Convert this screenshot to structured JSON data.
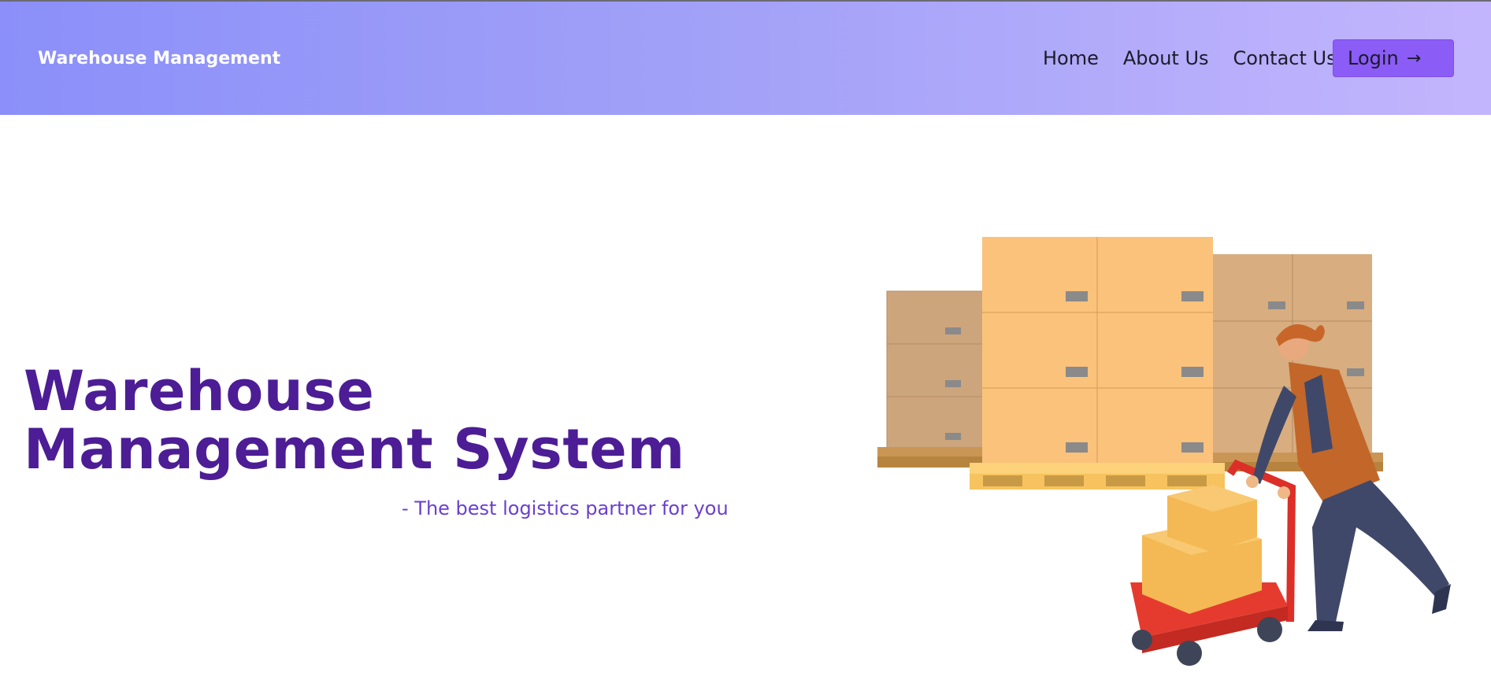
{
  "navbar": {
    "brand": "Warehouse Management",
    "links": [
      "Home",
      "About Us",
      "Contact Us"
    ],
    "login_label": "Login",
    "login_icon": "arrow-right-icon",
    "gradient_start": "#8b8ff9",
    "gradient_end": "#c3b5fd"
  },
  "hero": {
    "title_line1": "Warehouse",
    "title_line2": "Management System",
    "subtitle": "- The best logistics partner for you",
    "title_color": "#4c1d95",
    "subtitle_color": "#6a3fcf"
  },
  "illustration": {
    "name": "warehouse-worker-pushing-cart-illustration"
  },
  "colors": {
    "accent": "#8b5cf6"
  }
}
